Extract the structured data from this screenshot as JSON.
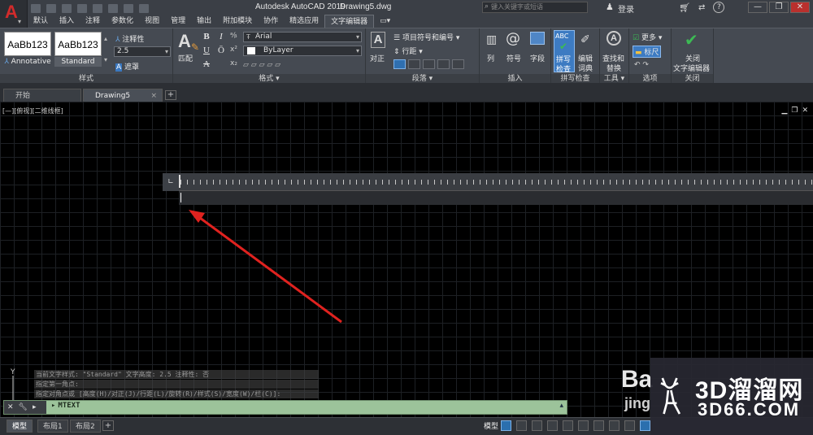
{
  "window": {
    "app_title": "Autodesk AutoCAD 2019",
    "file_name": "Drawing5.dwg",
    "search_placeholder": "键入关键字或短语",
    "login_label": "登录",
    "minimize": "—",
    "restore": "❐",
    "close": "✕"
  },
  "ribbon_tabs": [
    "默认",
    "插入",
    "注释",
    "参数化",
    "视图",
    "管理",
    "输出",
    "附加模块",
    "协作",
    "精选应用",
    "文字编辑器"
  ],
  "ribbon_active_tab": "文字编辑器",
  "panels": {
    "style": {
      "title": "样式",
      "style1_preview": "AaBb123",
      "style1_name": "Annotative",
      "style2_preview": "AaBb123",
      "style2_name": "Standard",
      "annotative_label": "注释性",
      "height_value": "2.5",
      "mask_label": "遮罩"
    },
    "format": {
      "title": "格式",
      "match_label": "匹配",
      "bold": "B",
      "italic": "I",
      "underline": "U",
      "overline": "Ō",
      "strike": "A",
      "font_value": "Arial",
      "color_value": "ByLayer"
    },
    "paragraph": {
      "title": "段落",
      "justify_label": "对正",
      "bullets_label": "项目符号和编号",
      "spacing_label": "行距"
    },
    "insert": {
      "title": "插入",
      "columns_label": "列",
      "symbol_label": "符号",
      "field_label": "字段"
    },
    "spell": {
      "title": "拼写检查",
      "spell_label_1": "拼写",
      "spell_label_2": "检查",
      "dict_label_1": "编辑",
      "dict_label_2": "词典"
    },
    "tools": {
      "title": "工具",
      "find_label_1": "查找和",
      "find_label_2": "替换"
    },
    "options": {
      "title": "选项",
      "more_label": "更多",
      "ruler_label": "标尺"
    },
    "close": {
      "title": "关闭",
      "close_label_1": "关闭",
      "close_label_2": "文字编辑器"
    }
  },
  "doc_tabs": {
    "start": "开始",
    "drawing": "Drawing5",
    "add": "+"
  },
  "viewport": {
    "label": "[—][俯视][二维线框]"
  },
  "command": {
    "history": [
      "当前文字样式: \"Standard\"  文字高度: 2.5  注释性: 否",
      "指定第一角点:",
      "指定对角点或 [高度(H)/对正(J)/行距(L)/旋转(R)/样式(S)/宽度(W)/栏(C)]:"
    ],
    "prompt": "MTEXT"
  },
  "layout_tabs": [
    "模型",
    "布局1",
    "布局2"
  ],
  "status": {
    "model_label": "模型"
  },
  "watermark": {
    "brand": "3D溜溜网",
    "url": "3D66.COM",
    "partial_1": "Ba",
    "partial_2": "jing"
  },
  "colors": {
    "accent": "#2f6fb0",
    "cmd_bar": "#9cc39a",
    "annotation_arrow": "#e0221f",
    "autocad_logo": "#d22b2b",
    "check_green": "#3cba54"
  }
}
